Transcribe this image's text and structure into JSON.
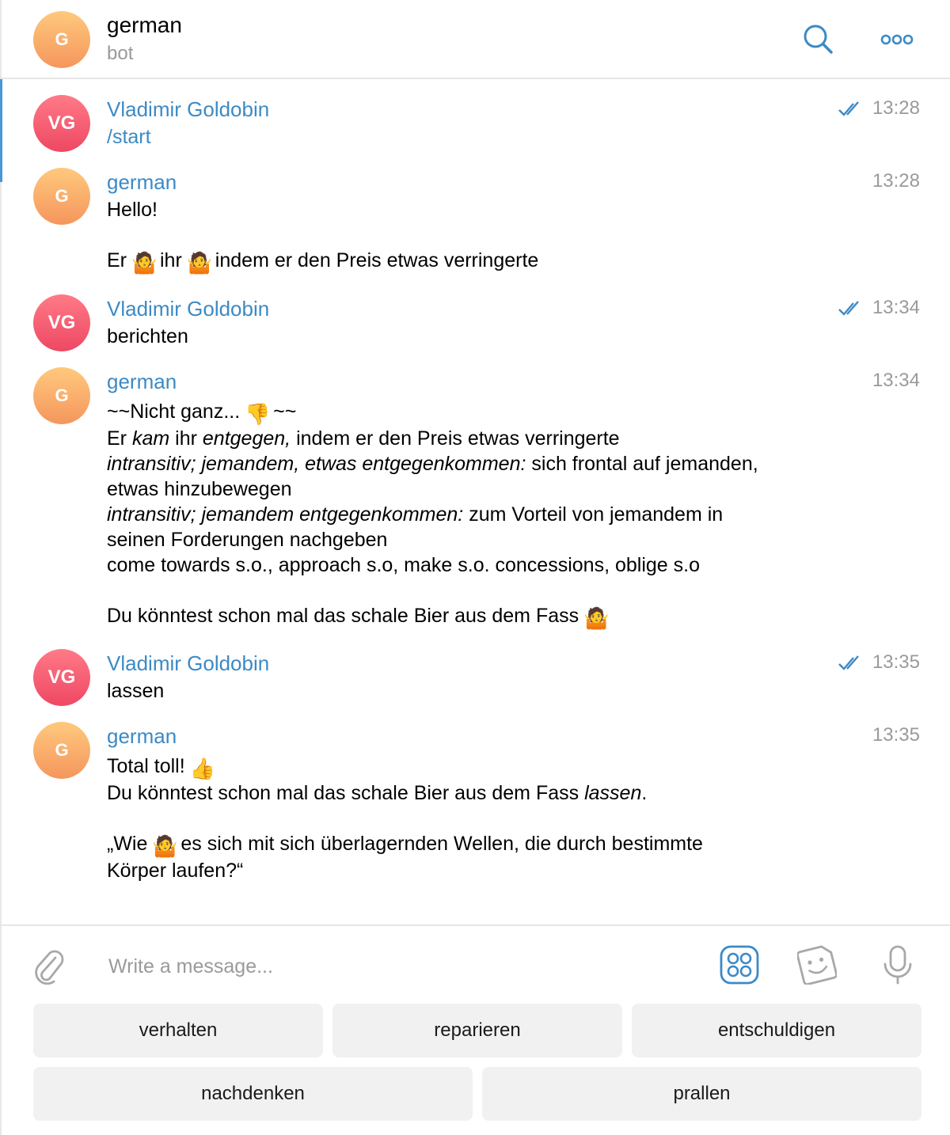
{
  "header": {
    "avatar_initials": "G",
    "title": "german",
    "subtitle": "bot",
    "search_icon": "search-icon",
    "more_icon": "more-icon"
  },
  "messages": [
    {
      "initials": "VG",
      "sender": "Vladimir Goldobin",
      "time": "13:28",
      "read": true,
      "text": "/start"
    },
    {
      "initials": "G",
      "sender": "german",
      "time": "13:28",
      "lines": [
        "Hello!",
        "",
        "Er",
        "ihr",
        "indem er den Preis etwas verringerte"
      ]
    },
    {
      "initials": "VG",
      "sender": "Vladimir Goldobin",
      "time": "13:34",
      "read": true,
      "text": "berichten"
    },
    {
      "initials": "G",
      "sender": "german",
      "time": "13:34",
      "l1a": "~~Nicht ganz...",
      "l1b": "~~",
      "l2": {
        "a": "Er",
        "b": "kam",
        "c": "ihr",
        "d": "entgegen,",
        "e": "indem er den Preis etwas verringerte"
      },
      "l3": {
        "i": "intransitiv; jemandem, etwas entgegenkommen:",
        "t": "sich frontal auf jemanden,"
      },
      "l4": "etwas hinzubewegen",
      "l5": {
        "i": "intransitiv; jemandem entgegenkommen:",
        "t": "zum Vorteil von jemandem in"
      },
      "l6": "seinen Forderungen nachgeben",
      "l7": "come towards s.o., approach s.o, make s.o. concessions, oblige s.o",
      "l8": "Du könntest schon mal das schale Bier aus dem Fass"
    },
    {
      "initials": "VG",
      "sender": "Vladimir Goldobin",
      "time": "13:35",
      "read": true,
      "text": "lassen"
    },
    {
      "initials": "G",
      "sender": "german",
      "time": "13:35",
      "l1": "Total toll!",
      "l2a": "Du könntest schon mal das schale Bier aus dem Fass",
      "l2b": "lassen",
      "l2c": ".",
      "l3a": "„Wie",
      "l3b": "es sich mit sich überlagernden Wellen, die durch bestimmte",
      "l4": "Körper laufen?“"
    }
  ],
  "composer": {
    "placeholder": "Write a message...",
    "icons": [
      "paperclip-icon",
      "bot-keyboard-icon",
      "sticker-icon",
      "microphone-icon"
    ]
  },
  "keyboard": {
    "row1": [
      "verhalten",
      "reparieren",
      "entschuldigen"
    ],
    "row2": [
      "nachdenken",
      "prallen"
    ]
  },
  "colors": {
    "accent": "#3c8ac5",
    "avatar_g": "#f5a25d",
    "avatar_vg": "#f0556e",
    "time_grey": "#9a9a9a",
    "button_bg": "#f1f1f1"
  },
  "emoji": {
    "shrug": "🤷",
    "thumbs_down": "👎",
    "thumbs_up": "👍"
  }
}
